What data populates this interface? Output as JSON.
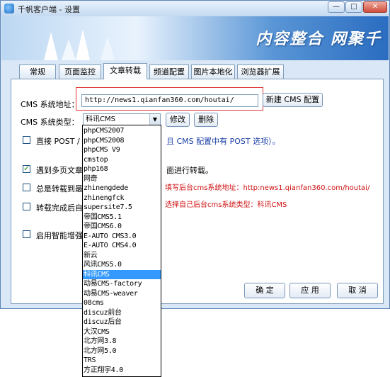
{
  "window": {
    "title": "千帆客户端 - 设置",
    "minimize_label": "—",
    "restore_label": "□",
    "close_label": "✕"
  },
  "banner": {
    "text": "内容整合 网聚千"
  },
  "tabs": [
    {
      "label": "常规"
    },
    {
      "label": "页面监控"
    },
    {
      "label": "文章转载"
    },
    {
      "label": "频道配置"
    },
    {
      "label": "图片本地化"
    },
    {
      "label": "浏览器扩展"
    }
  ],
  "form": {
    "cms_address_label": "CMS 系统地址：",
    "cms_address_value": "http://news1.qianfan360.com/houtai/",
    "new_cms_button": "新建 CMS 配置",
    "cms_type_label": "CMS 系统类型：",
    "cms_type_value": "科讯CMS",
    "edit_button": "修改",
    "delete_button": "删除",
    "option1_label": "直接 POST /",
    "option1_suffix": "且 CMS 配置中有 POST 选项）。",
    "option2_label": "遇到多页文章",
    "option2_suffix": "面进行转载。",
    "option3_label": "总是转载到最",
    "option4_label": "转载完成后自",
    "option5_label": "启用智能增强"
  },
  "notes": {
    "line1": "填写后台cms系统地址：http:news1.qianfan360.com/houtai/",
    "line2": "选择自己后台cms系统类型：科讯CMS"
  },
  "footer": {
    "ok_button": "确 定",
    "apply_button": "应 用",
    "cancel_button": "取 消"
  },
  "dropdown": {
    "selected_index": 16,
    "options": [
      "phpCMS2007",
      "phpCMS2008",
      "phpCMS V9",
      "cmstop",
      "php168",
      "网奇",
      "zhinengdede",
      "zhinengfck",
      "supersite7.5",
      "帝国CMS5.1",
      "帝国CMS6.0",
      "E-AUTO CMS3.0",
      "E-AUTO CMS4.0",
      "新云",
      "风讯CMS5.0",
      "科讯CMS",
      "动易CMS-factory",
      "动易CMS-weaver",
      "08cms",
      "discuz前台",
      "discuz后台",
      "大汉CMS",
      "北方网3.8",
      "北方网5.0",
      "TRS",
      "方正翔宇4.0"
    ]
  },
  "colors": {
    "accent": "#3399ff",
    "note_red": "#d01010",
    "highlight_box": "#e23a3a",
    "link_blue": "#1b3fa8"
  },
  "icons": {
    "app": "app-logo-icon",
    "dropdown": "chevron-down-icon",
    "checkbox": "check-icon"
  }
}
